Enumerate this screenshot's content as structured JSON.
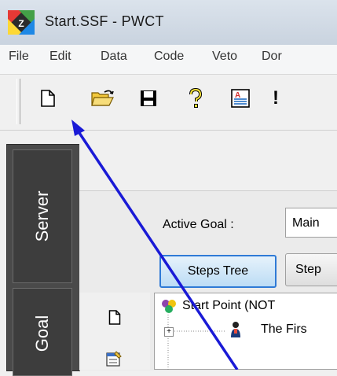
{
  "window": {
    "title": "Start.SSF  - PWCT"
  },
  "menu": {
    "items": [
      "File",
      "Edit",
      "Data",
      "Code",
      "Veto",
      "Dor"
    ]
  },
  "toolbar": {
    "buttons": [
      {
        "name": "new-file-icon"
      },
      {
        "name": "open-folder-icon"
      },
      {
        "name": "save-icon"
      },
      {
        "name": "help-icon"
      },
      {
        "name": "document-icon"
      },
      {
        "name": "run-icon",
        "glyph": "!"
      }
    ]
  },
  "side_tabs": {
    "server": "Server",
    "goal": "Goal"
  },
  "goal_bar": {
    "label": "Active Goal :",
    "value": "Main"
  },
  "view_tabs": {
    "steps_tree": "Steps Tree",
    "steps_other": "Step"
  },
  "tree": {
    "root": "Start Point (NOT",
    "child": "The Firs"
  },
  "annotation": {
    "color": "#1a1ad6"
  }
}
